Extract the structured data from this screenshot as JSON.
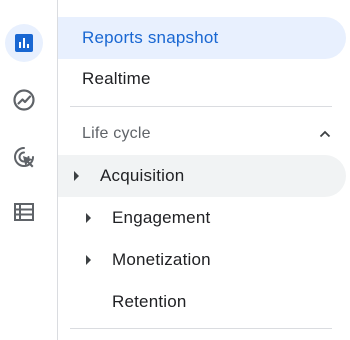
{
  "rail": {
    "items": [
      {
        "icon": "reports-bar-chart-icon",
        "active": true
      },
      {
        "icon": "explore-trend-icon",
        "active": false
      },
      {
        "icon": "advertising-cursor-icon",
        "active": false
      },
      {
        "icon": "configure-list-icon",
        "active": false
      }
    ]
  },
  "nav": {
    "reports_snapshot": "Reports snapshot",
    "realtime": "Realtime",
    "section_title": "Life cycle",
    "items": [
      {
        "label": "Acquisition"
      },
      {
        "label": "Engagement"
      },
      {
        "label": "Monetization"
      },
      {
        "label": "Retention"
      }
    ]
  },
  "colors": {
    "accent": "#1967d2",
    "selected_bg": "#e8f0fe",
    "icon_gray": "#5f6368"
  }
}
